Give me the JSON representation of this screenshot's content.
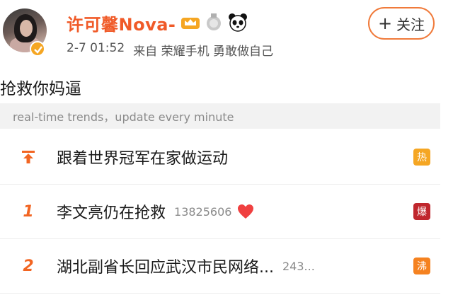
{
  "post": {
    "username": "许可馨Nova-",
    "timestamp": "2-7 01:52",
    "source": "来自 荣耀手机 勇敢做自己",
    "follow_label": "关注",
    "text": "抢救你妈逼",
    "icons": [
      "crown-icon",
      "medal-icon",
      "panda-icon",
      "verified-badge-icon"
    ]
  },
  "trends": {
    "header": "real-time trends，update every minute",
    "items": [
      {
        "rank": "",
        "rank_icon": "pin-up-arrow-icon",
        "title": "跟着世界冠军在家做运动",
        "count": "",
        "badge": "热",
        "badge_color": "#f5a623"
      },
      {
        "rank": "1",
        "title": "李文亮仍在抢救",
        "count": "13825606",
        "badge": "爆",
        "badge_color": "#c0272d",
        "extra_icon": "heart-icon"
      },
      {
        "rank": "2",
        "title": "湖北副省长回应武汉市民网络...",
        "count": "243...",
        "badge": "沸",
        "badge_color": "#f58220"
      }
    ]
  },
  "colors": {
    "accent_orange": "#f05a28",
    "rank_orange": "#f26522",
    "heart_red": "#f04040"
  }
}
